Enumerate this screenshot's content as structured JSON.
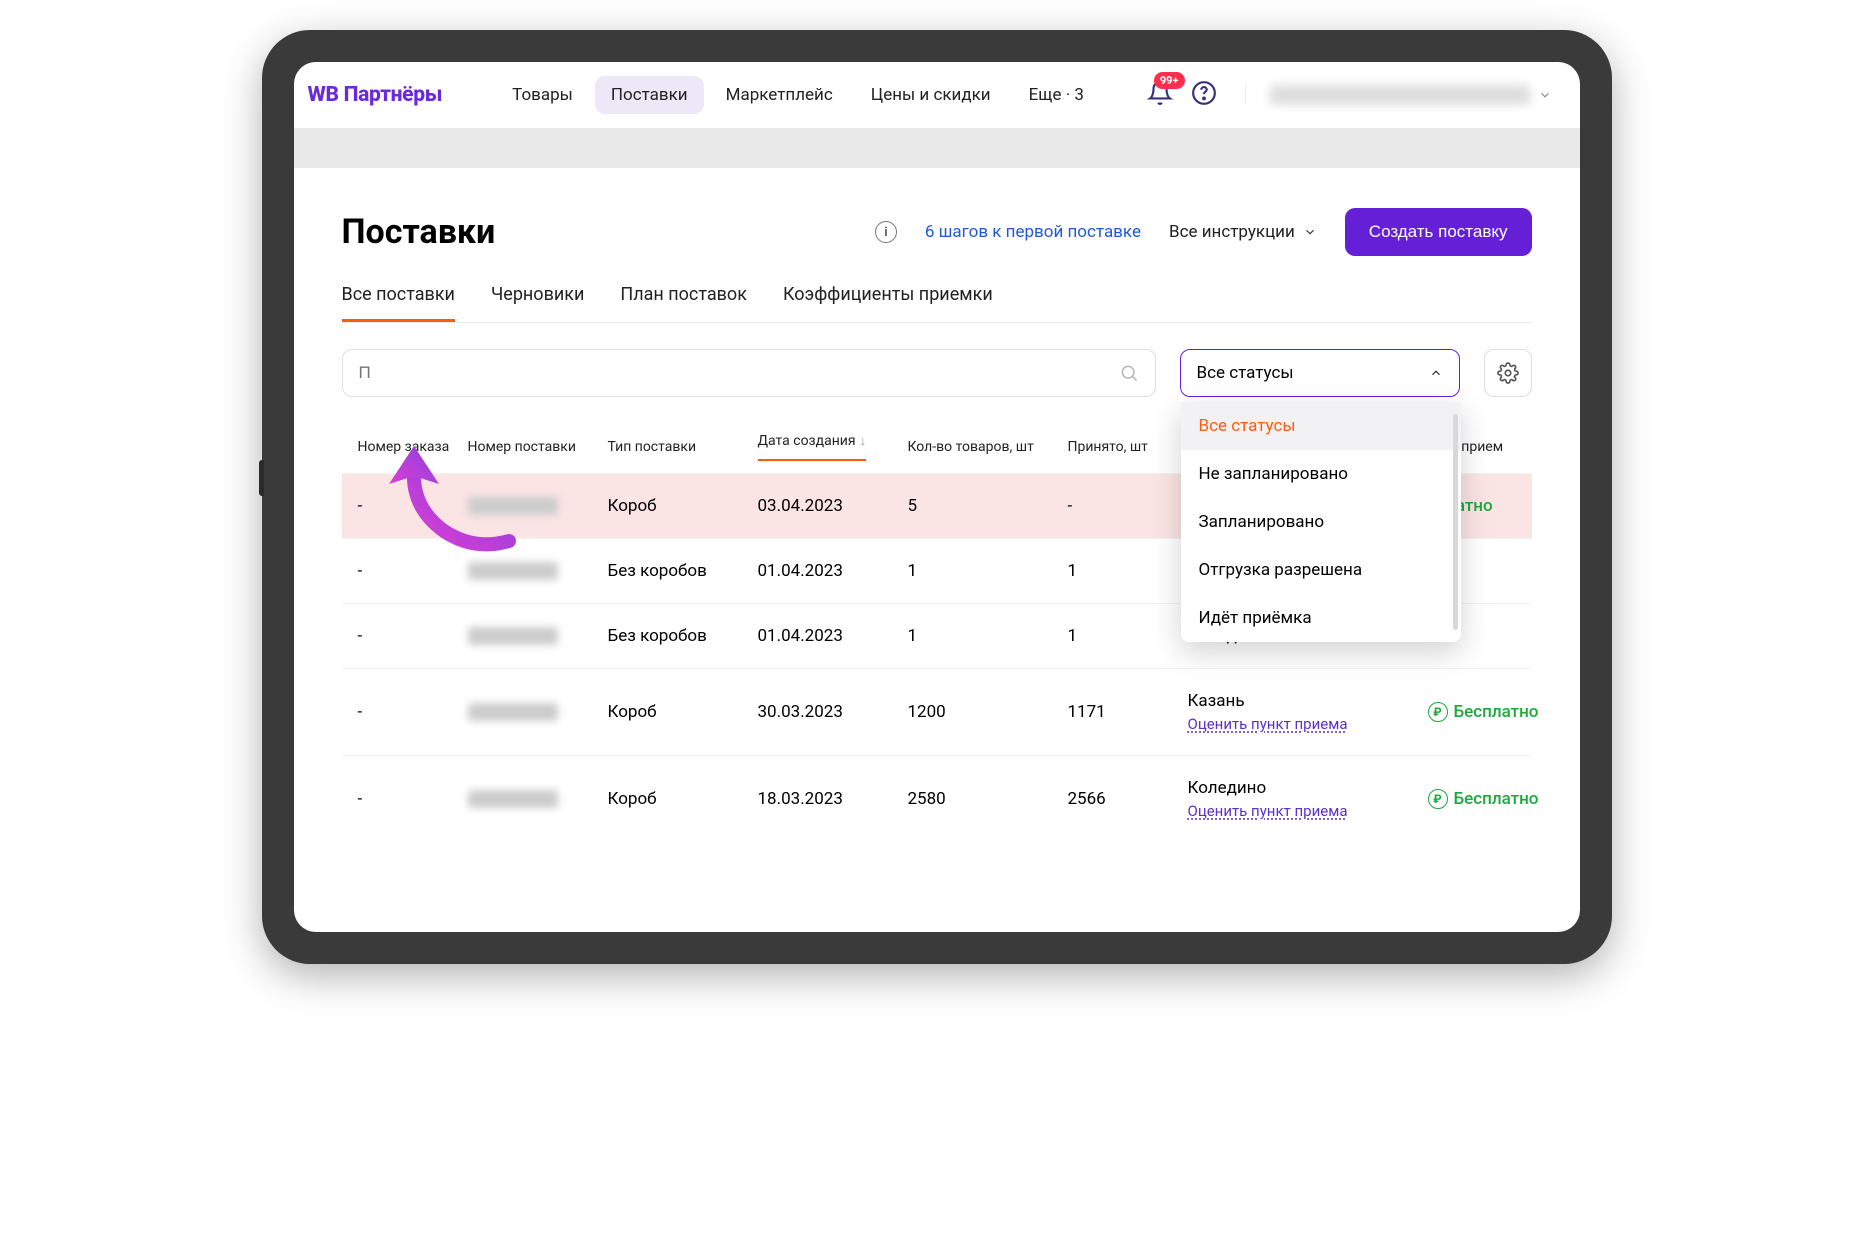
{
  "logo": "WB Партнёры",
  "nav": {
    "items": [
      "Товары",
      "Поставки",
      "Маркетплейс",
      "Цены и скидки",
      "Еще · 3"
    ],
    "active_index": 1
  },
  "notifications_badge": "99+",
  "page_title": "Поставки",
  "steps_link": "6 шагов к первой поставке",
  "instructions_link": "Все инструкции",
  "create_button": "Создать поставку",
  "subtabs": {
    "items": [
      "Все поставки",
      "Черновики",
      "План поставок",
      "Коэффициенты приемки"
    ],
    "active_index": 0
  },
  "search_placeholder": "П",
  "status_filter": {
    "selected": "Все статусы",
    "options": [
      "Все статусы",
      "Не запланировано",
      "Запланировано",
      "Отгрузка разрешена",
      "Идёт приёмка"
    ]
  },
  "table": {
    "columns": [
      "Номер заказа",
      "Номер поставки",
      "Тип поставки",
      "Дата создания",
      "Кол-во товаров, шт",
      "Принято, шт",
      "",
      "иент прием"
    ],
    "sorted_col_index": 3,
    "rows": [
      {
        "order": "-",
        "type": "Короб",
        "date": "03.04.2023",
        "qty": "5",
        "accepted": "-",
        "location": "",
        "rate": "",
        "coef": "сплатно",
        "highlight": true,
        "coef_cut": true
      },
      {
        "order": "-",
        "type": "Без коробов",
        "date": "01.04.2023",
        "qty": "1",
        "accepted": "1",
        "location": "",
        "rate": "",
        "coef": ""
      },
      {
        "order": "-",
        "type": "Без коробов",
        "date": "01.04.2023",
        "qty": "1",
        "accepted": "1",
        "location": "Коледино",
        "rate": "",
        "coef": "-"
      },
      {
        "order": "-",
        "type": "Короб",
        "date": "30.03.2023",
        "qty": "1200",
        "accepted": "1171",
        "location": "Казань",
        "rate": "Оценить пункт приема",
        "coef": "Бесплатно"
      },
      {
        "order": "-",
        "type": "Короб",
        "date": "18.03.2023",
        "qty": "2580",
        "accepted": "2566",
        "location": "Коледино",
        "rate": "Оценить пункт приема",
        "coef": "Бесплатно"
      }
    ]
  }
}
